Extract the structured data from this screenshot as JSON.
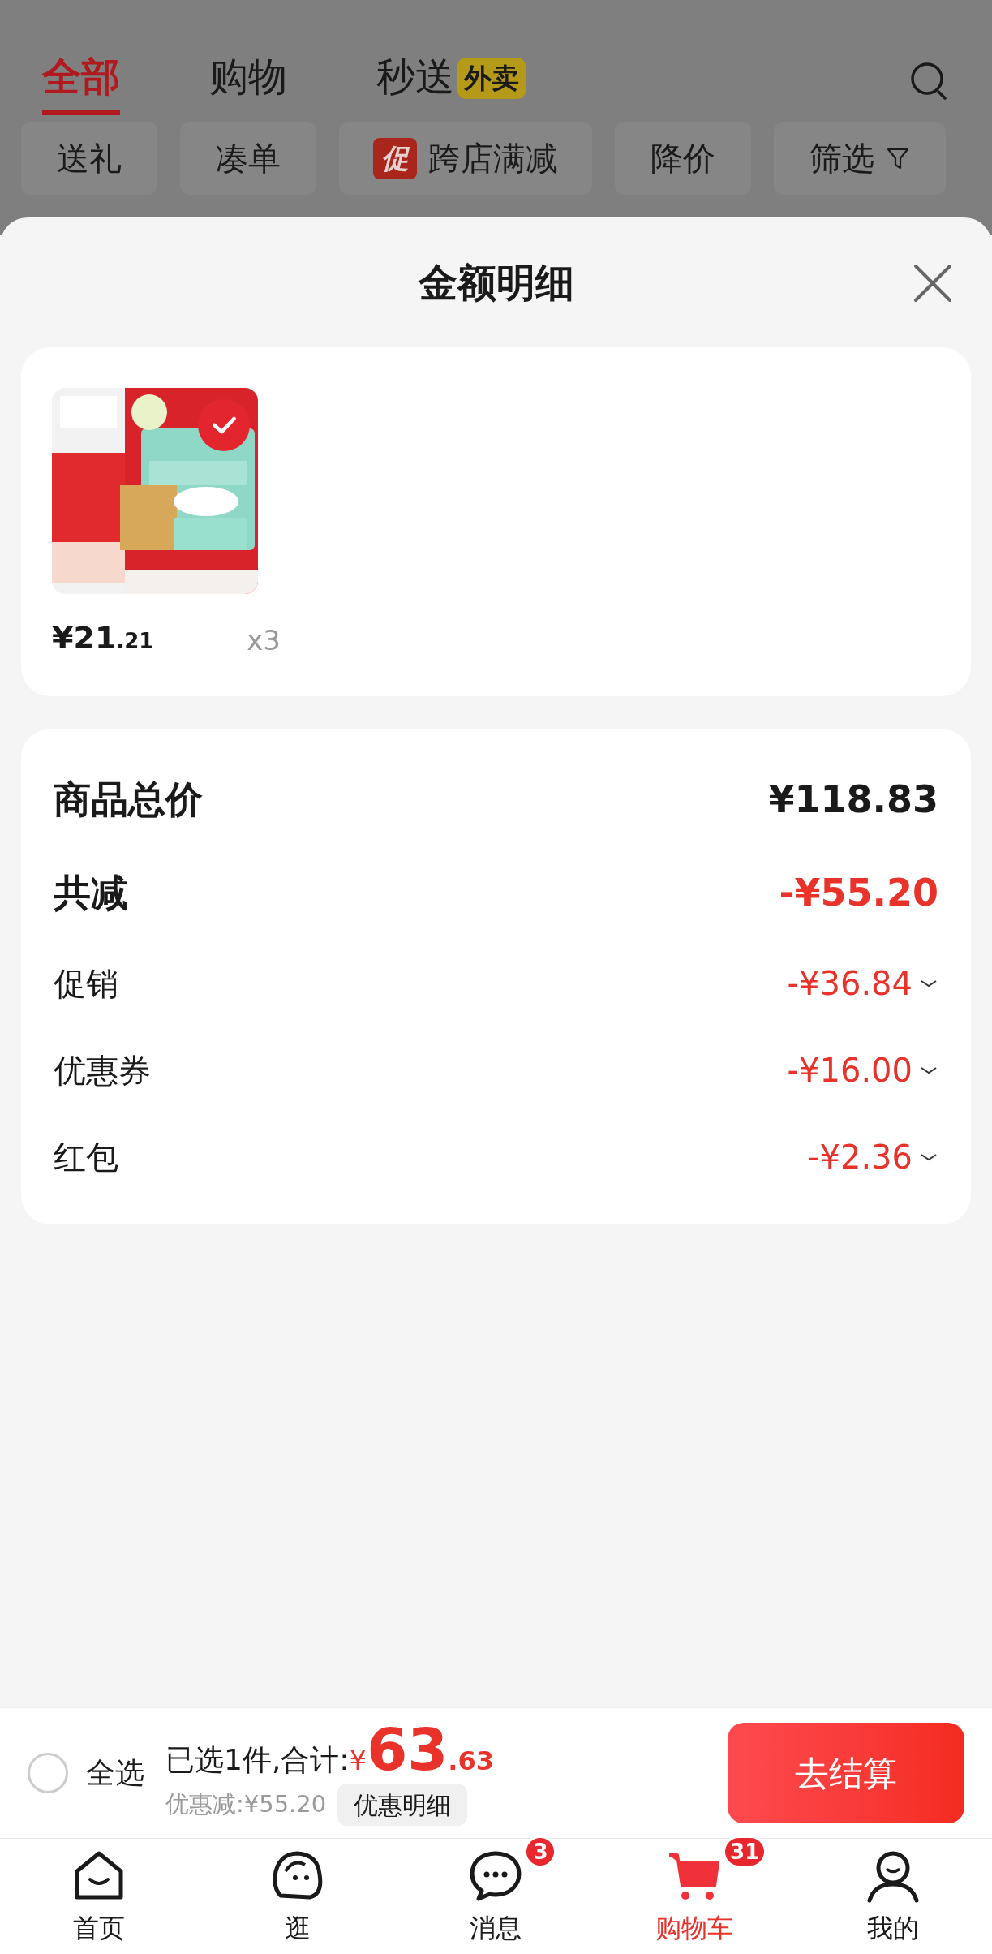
{
  "background": {
    "tabs": [
      {
        "label": "全部",
        "selected": true
      },
      {
        "label": "购物",
        "selected": false
      },
      {
        "label": "秒送",
        "selected": false,
        "badge": "外卖"
      }
    ],
    "filters": [
      {
        "label": "送礼",
        "kind": "plain"
      },
      {
        "label": "凑单",
        "kind": "plain"
      },
      {
        "label": "跨店满减",
        "kind": "promo",
        "tag": "促"
      },
      {
        "label": "降价",
        "kind": "plain"
      },
      {
        "label": "筛选",
        "kind": "filter"
      }
    ]
  },
  "sheet": {
    "title": "金额明细",
    "items": [
      {
        "kind": "picture",
        "checked": true,
        "price_main": "¥21",
        "price_cents": ".21",
        "quantity": "x3"
      }
    ],
    "summary": [
      {
        "kind": "total",
        "label": "商品总价",
        "value": "¥118.83"
      },
      {
        "kind": "reduction",
        "label": "共减",
        "value": "-¥55.20"
      },
      {
        "kind": "detail",
        "label": "促销",
        "value": "-¥36.84",
        "expanded": false
      },
      {
        "kind": "detail",
        "label": "优惠券",
        "value": "-¥16.00",
        "expanded": false
      },
      {
        "kind": "detail",
        "label": "红包",
        "value": "-¥2.36",
        "expanded": false
      }
    ]
  },
  "checkout": {
    "select_all": {
      "label": "全选",
      "checked": false
    },
    "summary_label": "已选1件,合计:",
    "currency": "¥",
    "total_main": "63",
    "total_cents": ".63",
    "discount": "优惠减:¥55.20",
    "details_button": "优惠明细",
    "checkout_button": "去结算"
  },
  "nav": [
    {
      "label": "首页",
      "selected": false
    },
    {
      "label": "逛",
      "selected": false
    },
    {
      "label": "消息",
      "selected": false,
      "badge": "3"
    },
    {
      "label": "购物车",
      "selected": true,
      "badge": "31"
    },
    {
      "label": "我的",
      "selected": false
    }
  ]
}
